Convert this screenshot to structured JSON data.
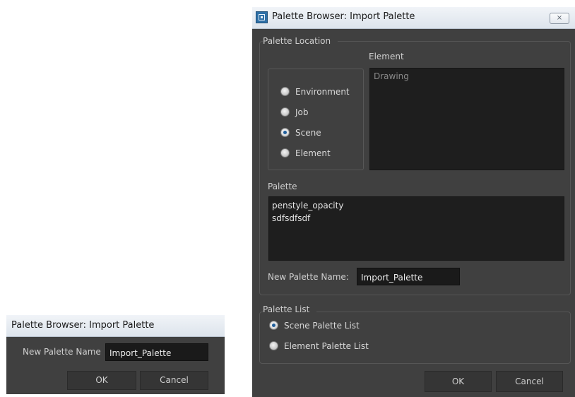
{
  "big_dialog": {
    "title": "Palette Browser: Import Palette",
    "close_glyph": "⨯",
    "palette_location": {
      "legend": "Palette Location",
      "options": [
        "Environment",
        "Job",
        "Scene",
        "Element"
      ],
      "selected": "Scene",
      "element_label": "Element",
      "element_items": [
        "Drawing"
      ]
    },
    "palette": {
      "label": "Palette",
      "items": [
        "penstyle_opacity",
        "sdfsdfsdf"
      ]
    },
    "new_palette_name": {
      "label": "New Palette Name:",
      "value": "Import_Palette"
    },
    "palette_list": {
      "legend": "Palette List",
      "options": [
        "Scene Palette List",
        "Element Palette List"
      ],
      "selected": "Scene Palette List"
    },
    "buttons": {
      "ok": "OK",
      "cancel": "Cancel"
    }
  },
  "small_dialog": {
    "title": "Palette Browser: Import Palette",
    "new_palette_name_label": "New Palette Name",
    "new_palette_name_value": "Import_Palette",
    "buttons": {
      "ok": "OK",
      "cancel": "Cancel"
    }
  },
  "colors": {
    "dialog_bg": "#404040",
    "list_bg": "#1e1e1e",
    "titlebar": "#e6ebf1",
    "radio_accent": "#1f5e9b"
  },
  "icons": {
    "app": "palette-browser-app-icon",
    "close": "close-icon"
  }
}
